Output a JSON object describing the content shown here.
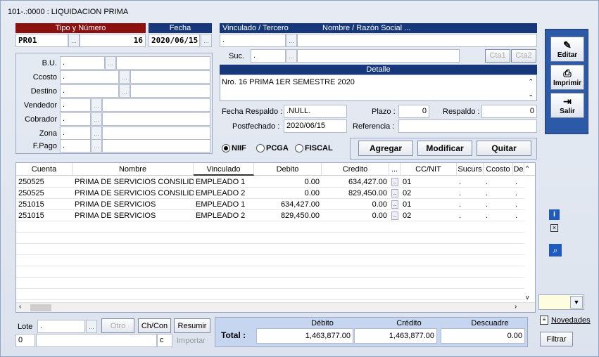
{
  "window": {
    "title": "101-.:0000 : LIQUIDACION PRIMA"
  },
  "doc": {
    "tipo_header": "Tipo y Número",
    "fecha_header": "Fecha",
    "tipo": "PR01",
    "numero": "16",
    "fecha": "2020/06/15"
  },
  "left_fields": [
    {
      "label": "B.U.",
      "value": "."
    },
    {
      "label": "Ccosto",
      "value": "."
    },
    {
      "label": "Destino",
      "value": "."
    },
    {
      "label": "Vendedor",
      "value": "."
    },
    {
      "label": "Cobrador",
      "value": "."
    },
    {
      "label": "Zona",
      "value": "."
    },
    {
      "label": "F.Pago",
      "value": "."
    }
  ],
  "tercero": {
    "vinculado_header": "Vinculado / Tercero",
    "nombre_header": "Nombre / Razón Social ...",
    "vinculado_value": ".",
    "suc_label": "Suc.",
    "suc_value": ".",
    "cta1": "Cta1",
    "cta2": "Cta2"
  },
  "detalle": {
    "header": "Detalle",
    "text": "Nro. 16 PRIMA 1ER SEMESTRE 2020"
  },
  "extra": {
    "fecha_respaldo_label": "Fecha Respaldo :",
    "fecha_respaldo_value": ".NULL.",
    "plazo_label": "Plazo :",
    "plazo_value": "0",
    "respaldo_label": "Respaldo :",
    "respaldo_value": "0",
    "postfechado_label": "Postfechado :",
    "postfechado_value": "2020/06/15",
    "referencia_label": "Referencia :",
    "referencia_value": ""
  },
  "norms": {
    "niif": "NIIF",
    "pcga": "PCGA",
    "fiscal": "FISCAL",
    "selected": "NIIF"
  },
  "actions": {
    "agregar": "Agregar",
    "modificar": "Modificar",
    "quitar": "Quitar"
  },
  "sidebar": {
    "editar": "Editar",
    "imprimir": "Imprimir",
    "salir": "Salir"
  },
  "grid": {
    "columns": [
      "Cuenta",
      "Nombre",
      "Vinculado",
      "Debito",
      "Credito",
      "...",
      "CC/NIT",
      "Sucurs",
      "Ccosto",
      "De"
    ],
    "rows": [
      {
        "cuenta": "250525",
        "nombre": "PRIMA DE SERVICIOS CONSILIDAD",
        "vinculado": "EMPLEADO 1",
        "debito": "0.00",
        "credito": "634,427.00",
        "ccnit": "01",
        "sucurs": ".",
        "ccosto": ".",
        "de": "."
      },
      {
        "cuenta": "250525",
        "nombre": "PRIMA DE SERVICIOS CONSILIDAD",
        "vinculado": "EMPLEADO 2",
        "debito": "0.00",
        "credito": "829,450.00",
        "ccnit": "02",
        "sucurs": ".",
        "ccosto": ".",
        "de": "."
      },
      {
        "cuenta": "251015",
        "nombre": "PRIMA DE SERVICIOS",
        "vinculado": "EMPLEADO 1",
        "debito": "634,427.00",
        "credito": "0.00",
        "ccnit": "01",
        "sucurs": ".",
        "ccosto": ".",
        "de": "."
      },
      {
        "cuenta": "251015",
        "nombre": "PRIMA DE SERVICIOS",
        "vinculado": "EMPLEADO 2",
        "debito": "829,450.00",
        "credito": "0.00",
        "ccnit": "02",
        "sucurs": ".",
        "ccosto": ".",
        "de": "."
      }
    ]
  },
  "bottom": {
    "lote_label": "Lote",
    "lote_value": ".",
    "otro": "Otro",
    "chcon": "Ch/Con",
    "resumir": "Resumir",
    "importar": "Importar",
    "counter": "0",
    "c_label": "c"
  },
  "totals": {
    "label": "Total :",
    "debito_header": "Débito",
    "credito_header": "Crédito",
    "descuadre_header": "Descuadre",
    "debito": "1,463,877.00",
    "credito": "1,463,877.00",
    "descuadre": "0.00"
  },
  "right_bottom": {
    "novedades": "Novedades",
    "filtrar": "Filtrar"
  }
}
